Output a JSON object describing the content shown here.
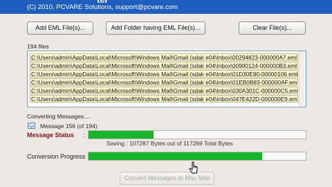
{
  "header": {
    "title_fragment": "ter",
    "copyright": "(C) 2010, PCVARE Solutions, support@pcvare.com"
  },
  "toolbar": {
    "add_eml_files": "Add EML File(s)...",
    "add_folder": "Add Folder having EML File(s)...",
    "clear_files": "Clear File(s)..."
  },
  "file_list": {
    "count_label": "194 files",
    "items": [
      "C:\\Users\\admin\\AppData\\Local\\Microsoft\\Windows Mail\\Gmail (sdak e04\\Inbox\\00294823-000000A7.eml",
      "C:\\Users\\admin\\AppData\\Local\\Microsoft\\Windows Mail\\Gmail (sdak e04\\Inbox\\00990124-000000B3.eml",
      "C:\\Users\\admin\\AppData\\Local\\Microsoft\\Windows Mail\\Gmail (sdak e04\\Inbox\\01D30E90-00000106.eml",
      "C:\\Users\\admin\\AppData\\Local\\Microsoft\\Windows Mail\\Gmail (sdak e04\\Inbox\\01EB0B83-000000AF.eml",
      "C:\\Users\\admin\\AppData\\Local\\Microsoft\\Windows Mail\\Gmail (sdak e04\\Inbox\\030A301C-000000C5.eml",
      "C:\\Users\\admin\\AppData\\Local\\Microsoft\\Windows Mail\\Gmail (sdak e04\\Inbox\\047E422D-000000E9.eml"
    ]
  },
  "conversion": {
    "status_line": "Converting Messages....",
    "message_counter": "Message 156 (of 194)",
    "message_status_label": "Message Status",
    "colon": ":",
    "bytes_text": "Saving :  107287 Bytes out of 117269 Total Bytes",
    "conversion_progress_label": "Conversion Progress",
    "message_progress": 0.3,
    "overall_progress": 0.8
  },
  "actions": {
    "convert_button": "Convert Messages to Mac Mail"
  },
  "colors": {
    "header_bg": "#1f5ebe",
    "progress_fill": "#17b52c",
    "status_label": "#8b0f1b",
    "selected_row_bg": "#fbf6cd"
  },
  "icons": {
    "message": "envelope-icon",
    "cursor": "mouse-pointer-icon"
  }
}
